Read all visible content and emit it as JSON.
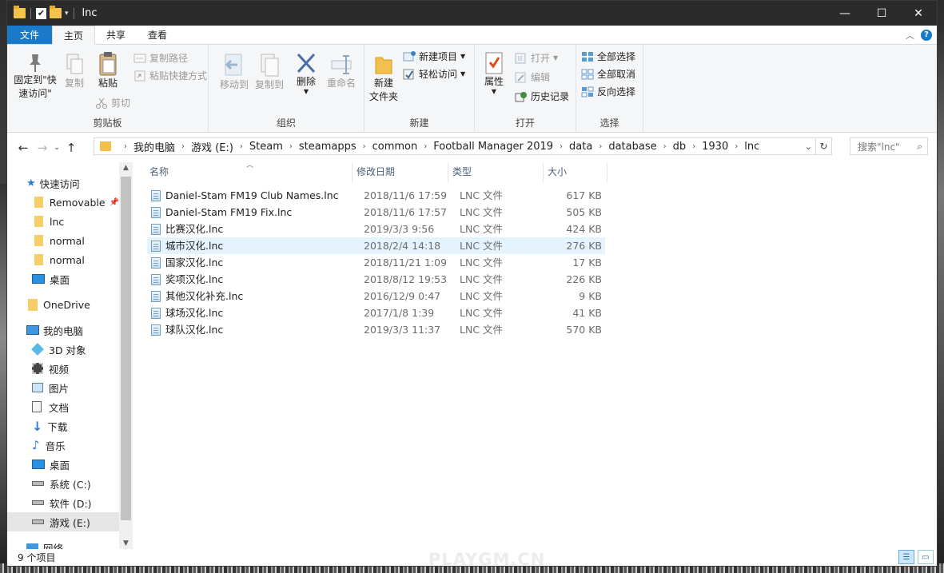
{
  "window": {
    "title": "lnc",
    "controls": {
      "minimize": "—",
      "maximize": "☐",
      "close": "✕"
    }
  },
  "ribbon_tabs": [
    {
      "label": "文件"
    },
    {
      "label": "主页"
    },
    {
      "label": "共享"
    },
    {
      "label": "查看"
    }
  ],
  "ribbon": {
    "clipboard": {
      "pin": "固定到\"快\n速访问\"",
      "copy": "复制",
      "paste": "粘贴",
      "copy_path": "复制路径",
      "paste_shortcut": "粘贴快捷方式",
      "cut": "剪切",
      "label": "剪贴板"
    },
    "organize": {
      "move_to": "移动到",
      "copy_to": "复制到",
      "delete": "删除",
      "rename": "重命名",
      "label": "组织"
    },
    "new": {
      "new_folder": "新建\n文件夹",
      "new_item": "新建项目",
      "easy_access": "轻松访问",
      "label": "新建"
    },
    "open": {
      "properties": "属性",
      "open": "打开",
      "edit": "编辑",
      "history": "历史记录",
      "label": "打开"
    },
    "select": {
      "select_all": "全部选择",
      "select_none": "全部取消",
      "invert": "反向选择",
      "label": "选择"
    }
  },
  "address": {
    "crumbs": [
      "我的电脑",
      "游戏 (E:)",
      "Steam",
      "steamapps",
      "common",
      "Football Manager 2019",
      "data",
      "database",
      "db",
      "1930",
      "lnc"
    ],
    "search_placeholder": "搜索\"lnc\""
  },
  "nav_pane": {
    "quick_access": "快速访问",
    "items": [
      {
        "label": "Removable"
      },
      {
        "label": "lnc"
      },
      {
        "label": "normal"
      },
      {
        "label": "normal"
      },
      {
        "label": "桌面"
      }
    ],
    "onedrive": "OneDrive",
    "this_pc": "我的电脑",
    "pc_items": [
      {
        "label": "3D 对象"
      },
      {
        "label": "视频"
      },
      {
        "label": "图片"
      },
      {
        "label": "文档"
      },
      {
        "label": "下载"
      },
      {
        "label": "音乐"
      },
      {
        "label": "桌面"
      },
      {
        "label": "系统 (C:)"
      },
      {
        "label": "软件 (D:)"
      },
      {
        "label": "游戏 (E:)"
      }
    ],
    "network": "网络"
  },
  "columns": {
    "name": "名称",
    "date": "修改日期",
    "type": "类型",
    "size": "大小"
  },
  "files": [
    {
      "name": "Daniel-Stam FM19 Club Names.lnc",
      "date": "2018/11/6 17:59",
      "type": "LNC 文件",
      "size": "617 KB"
    },
    {
      "name": "Daniel-Stam FM19 Fix.lnc",
      "date": "2018/11/6 17:57",
      "type": "LNC 文件",
      "size": "505 KB"
    },
    {
      "name": "比赛汉化.lnc",
      "date": "2019/3/3 9:56",
      "type": "LNC 文件",
      "size": "424 KB"
    },
    {
      "name": "城市汉化.lnc",
      "date": "2018/2/4 14:18",
      "type": "LNC 文件",
      "size": "276 KB"
    },
    {
      "name": "国家汉化.lnc",
      "date": "2018/11/21 1:09",
      "type": "LNC 文件",
      "size": "17 KB"
    },
    {
      "name": "奖项汉化.lnc",
      "date": "2018/8/12 19:53",
      "type": "LNC 文件",
      "size": "226 KB"
    },
    {
      "name": "其他汉化补充.lnc",
      "date": "2016/12/9 0:47",
      "type": "LNC 文件",
      "size": "9 KB"
    },
    {
      "name": "球场汉化.lnc",
      "date": "2017/1/8 1:39",
      "type": "LNC 文件",
      "size": "41 KB"
    },
    {
      "name": "球队汉化.lnc",
      "date": "2019/3/3 11:37",
      "type": "LNC 文件",
      "size": "570 KB"
    }
  ],
  "status": {
    "count": "9 个项目"
  },
  "watermark": "PLAYGM.CN"
}
